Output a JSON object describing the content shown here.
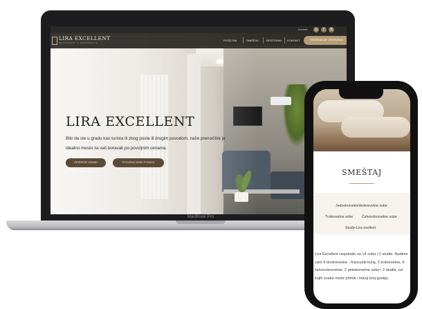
{
  "laptop": {
    "brand_label": "MacBook Pro",
    "site": {
      "topbar_text": "Kontakt",
      "social_icons": [
        "instagram-icon",
        "facebook-icon",
        "booking-icon"
      ],
      "logo_title": "LIRA EXCELLENT",
      "logo_subtitle": "RESTAURANT & APARTMENTS",
      "nav": [
        "POČETNA",
        "SMEŠTAJ",
        "RESTORAN",
        "KONTAKT"
      ],
      "cta": "REZERVACIJE | RESTORAN",
      "hero_title": "LIRA EXCELLENT",
      "hero_text": "Bilo da ste u gradu kao turista ili zbog posla ili drugim povodom, naše prenoćište je idealno mesto za vaš boravak po povoljnim cenama.",
      "buttons": [
        "REZERVIŠI ODMAH",
        "POGLEDAJ NAŠU PONUDU"
      ]
    }
  },
  "phone": {
    "heading": "SMEŠTAJ",
    "room_types": [
      "Jednokrevetni/dvokrevetne sobe",
      "Trokrevetne sobe",
      "Četvorokrevetne sobe",
      "Studio Lira exellent"
    ],
    "description": "Lira Excellent raspolaže sa 14 soba i 2 studia. Nudimo vam 4 dvokrevetne - francuski ležaj, 2 trokrevetne, 6 četvorokrevetne, 2 petokrevetne sobe i 2 studia, od kojih svaka može primiti i manji broj gostiju."
  },
  "colors": {
    "accent_gold": "#b59d76",
    "button_brown": "#5b4a36",
    "nav_dark": "#2a2925",
    "device_black": "#1d1d1f"
  }
}
